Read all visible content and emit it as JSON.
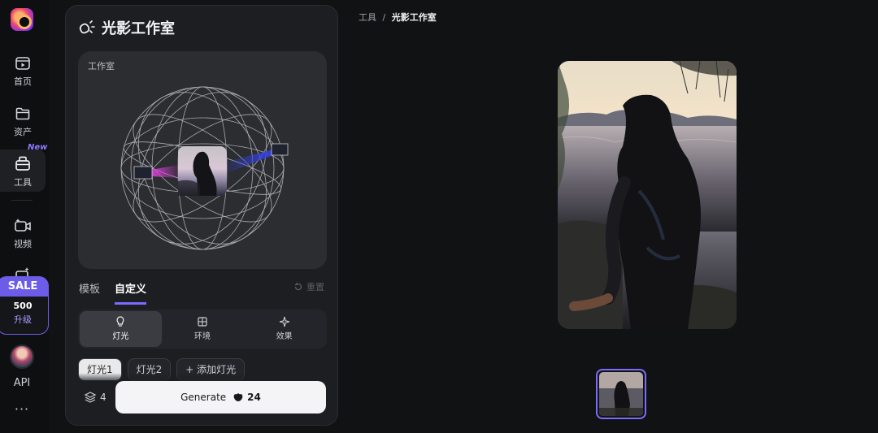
{
  "sidebar": {
    "items": [
      {
        "label": "首页",
        "icon": "play-square-icon"
      },
      {
        "label": "资产",
        "icon": "folder-icon"
      },
      {
        "label": "工具",
        "icon": "toolbox-icon",
        "badge": "New"
      },
      {
        "label": "视频",
        "icon": "video-sparkle-icon"
      }
    ],
    "sale": {
      "tag": "SALE",
      "amount": "500",
      "upgrade": "升级"
    },
    "api_label": "API",
    "more": "···"
  },
  "panel": {
    "title": "光影工作室",
    "studio_label": "工作室",
    "tabs": [
      "模板",
      "自定义"
    ],
    "active_tab": "自定义",
    "reset_label": "重置",
    "segments": [
      {
        "label": "灯光",
        "icon": "bulb-icon"
      },
      {
        "label": "环境",
        "icon": "grid-icon"
      },
      {
        "label": "效果",
        "icon": "sparkle-icon"
      }
    ],
    "chips": [
      "灯光1",
      "灯光2",
      "+ 添加灯光"
    ],
    "layers_count": "4",
    "generate": {
      "label": "Generate",
      "cost": "24"
    }
  },
  "breadcrumb": {
    "parent": "工具",
    "separator": "/",
    "current": "光影工作室"
  },
  "colors": {
    "accent": "#7b6cff",
    "light_left": "#d23fd1",
    "light_right": "#3340e0",
    "panel_bg": "#1c1e22"
  }
}
